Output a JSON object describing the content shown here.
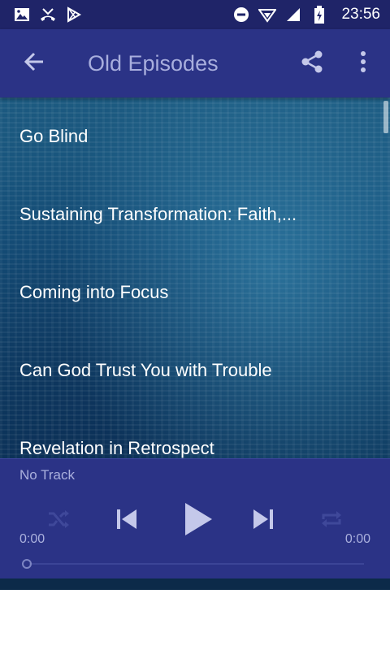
{
  "status_bar": {
    "time": "23:56",
    "icons": [
      "image-icon",
      "missed-call-icon",
      "play-store-icon",
      "do-not-disturb-icon",
      "wifi-icon",
      "signal-icon",
      "battery-charging-icon"
    ]
  },
  "app_bar": {
    "title": "Old Episodes",
    "icons": [
      "back-arrow-icon",
      "share-icon",
      "more-vert-icon"
    ]
  },
  "episodes": [
    {
      "title": "Go Blind"
    },
    {
      "title": "Sustaining Transformation: Faith,..."
    },
    {
      "title": "Coming into Focus"
    },
    {
      "title": "Can God Trust You with Trouble"
    },
    {
      "title": "Revelation in Retrospect"
    }
  ],
  "player": {
    "track_name": "No Track",
    "elapsed": "0:00",
    "duration": "0:00",
    "progress": 0,
    "controls": [
      "shuffle-icon",
      "skip-previous-icon",
      "play-icon",
      "skip-next-icon",
      "repeat-icon"
    ]
  },
  "colors": {
    "status_bar": "#1f2468",
    "app_bar": "#2b3386",
    "title_text": "#a8aedd",
    "player_bg": "#2b3386",
    "player_text": "#aab0dd"
  }
}
